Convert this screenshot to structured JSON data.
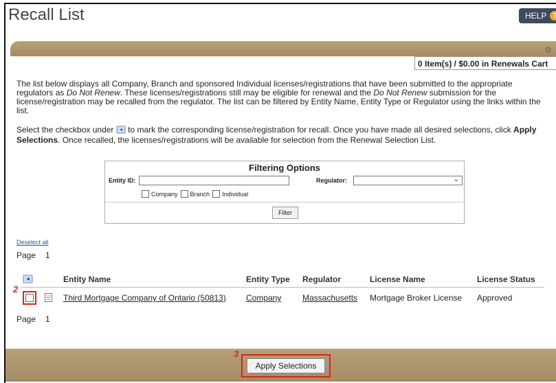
{
  "header": {
    "title": "Recall List",
    "help_label": "HELP",
    "help_badge": "?"
  },
  "cart": {
    "summary": "0 Item(s) / $0.00 in Renewals Cart"
  },
  "intro": {
    "part1": "The list below displays all Company, Branch and sponsored Individual licenses/registrations that have been submitted to the appropriate regulators as ",
    "dnr1": "Do Not Renew",
    "part2": ". These licenses/registrations still may be eligible for renewal and the ",
    "dnr2": "Do Not Renew",
    "part3": " submission for the license/registration may be recalled from the regulator. The list can be filtered by Entity Name, Entity Type or Regulator using the links within the list."
  },
  "instructions": {
    "part1": "Select the checkbox under ",
    "part2": " to mark the corresponding license/registration for recall. Once you have made all desired selections, click ",
    "apply_bold": "Apply Selections",
    "part3": ". Once recalled, the licenses/registrations will be available for selection from the Renewal Selection List."
  },
  "filter": {
    "title": "Filtering Options",
    "entity_id_label": "Entity ID:",
    "entity_id_value": "",
    "regulator_label": "Regulator:",
    "regulator_value": "",
    "checkboxes": [
      "Company",
      "Branch",
      "Individual"
    ],
    "filter_button": "Filter"
  },
  "list": {
    "deselect_all": "Deselect all",
    "page_label": "Page",
    "page_number": "1",
    "columns": [
      "Entity Name",
      "Entity Type",
      "Regulator",
      "License Name",
      "License Status"
    ],
    "rows": [
      {
        "entity_name": "Third Mortgage Company of Ontario (50813)",
        "entity_type": "Company",
        "regulator": "Massachusetts",
        "license_name": "Mortgage Broker License",
        "license_status": "Approved"
      }
    ]
  },
  "annotations": {
    "step2": "2",
    "step3": "3"
  },
  "footer": {
    "apply_button": "Apply Selections"
  },
  "colors": {
    "band": "#a48c64",
    "link": "#1f5ea8",
    "highlight": "#dd2222",
    "help_bg": "#3e4a5f",
    "help_badge": "#f0a81c"
  }
}
